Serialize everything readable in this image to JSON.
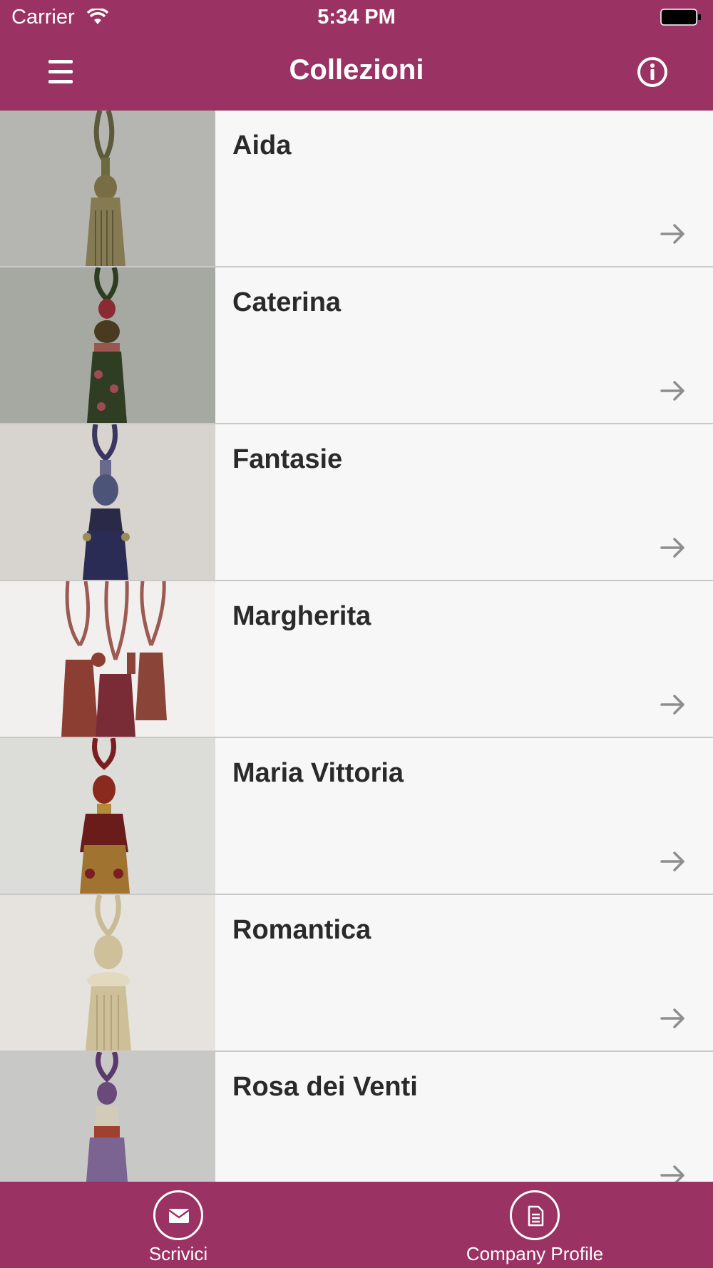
{
  "status_bar": {
    "carrier": "Carrier",
    "time": "5:34 PM"
  },
  "nav": {
    "title": "Collezioni"
  },
  "collections": [
    {
      "name": "Aida"
    },
    {
      "name": "Caterina"
    },
    {
      "name": "Fantasie"
    },
    {
      "name": "Margherita"
    },
    {
      "name": "Maria Vittoria"
    },
    {
      "name": "Romantica"
    },
    {
      "name": "Rosa dei Venti"
    }
  ],
  "tab_bar": {
    "scrivici_label": "Scrivici",
    "company_label": "Company Profile"
  },
  "colors": {
    "brand": "#9a3263",
    "row_bg": "#f7f7f7",
    "arrow": "#8e8e8e"
  }
}
